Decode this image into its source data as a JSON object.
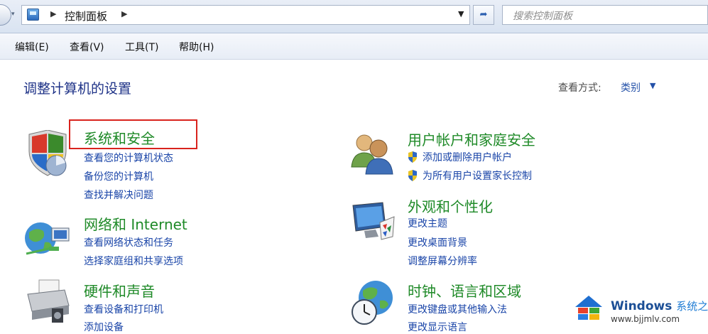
{
  "address_bar": {
    "breadcrumb": "控制面板",
    "refresh_icon": "refresh-icon",
    "search_placeholder": "搜索控制面板"
  },
  "menu": [
    {
      "label": "编辑(E)"
    },
    {
      "label": "查看(V)"
    },
    {
      "label": "工具(T)"
    },
    {
      "label": "帮助(H)"
    }
  ],
  "main": {
    "title": "调整计算机的设置",
    "view_by_label": "查看方式:",
    "view_by_value": "类别"
  },
  "categories": [
    {
      "title": "系统和安全",
      "icon": "shield-pie-icon",
      "links": [
        "查看您的计算机状态",
        "备份您的计算机",
        "查找并解决问题"
      ]
    },
    {
      "title": "网络和 Internet",
      "icon": "network-globe-icon",
      "links": [
        "查看网络状态和任务",
        "选择家庭组和共享选项"
      ]
    },
    {
      "title": "硬件和声音",
      "icon": "printer-icon",
      "links": [
        "查看设备和打印机",
        "添加设备"
      ]
    },
    {
      "title": "用户帐户和家庭安全",
      "icon": "users-icon",
      "links": [
        "添加或删除用户帐户",
        "为所有用户设置家长控制"
      ]
    },
    {
      "title": "外观和个性化",
      "icon": "monitor-palette-icon",
      "links": [
        "更改主题",
        "更改桌面背景",
        "调整屏幕分辨率"
      ]
    },
    {
      "title": "时钟、语言和区域",
      "icon": "globe-clock-icon",
      "links": [
        "更改键盘或其他输入法",
        "更改显示语言"
      ]
    }
  ],
  "colors": {
    "category_title": "#1f8a28",
    "link": "#1a45a8",
    "highlight_box": "#d9231d"
  },
  "watermark": {
    "brand": "Windows",
    "brand_cn": "系统之家",
    "url": "www.bjjmlv.com"
  }
}
